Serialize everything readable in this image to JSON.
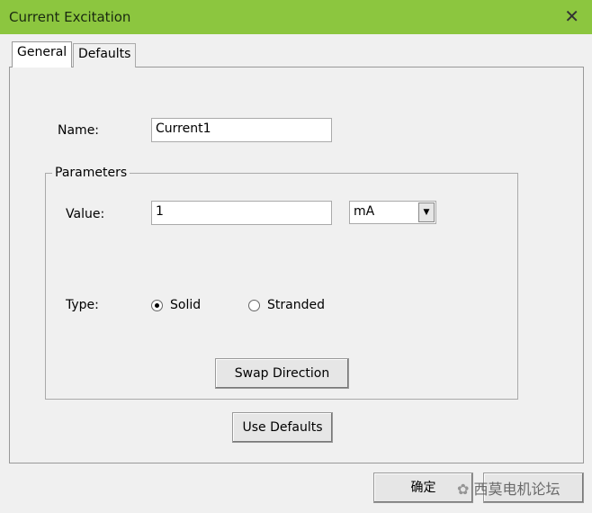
{
  "window": {
    "title": "Current Excitation",
    "close_icon": "close-icon"
  },
  "tabs": [
    {
      "label": "General",
      "active": true
    },
    {
      "label": "Defaults",
      "active": false
    }
  ],
  "name": {
    "label": "Name:",
    "value": "Current1"
  },
  "parameters": {
    "title": "Parameters",
    "value_label": "Value:",
    "value": "1",
    "unit": "mA",
    "type_label": "Type:",
    "type_options": [
      {
        "label": "Solid",
        "selected": true
      },
      {
        "label": "Stranded",
        "selected": false
      }
    ],
    "swap_label": "Swap Direction"
  },
  "use_defaults_label": "Use Defaults",
  "footer": {
    "ok_label": "确定",
    "watermark": "西莫电机论坛"
  }
}
